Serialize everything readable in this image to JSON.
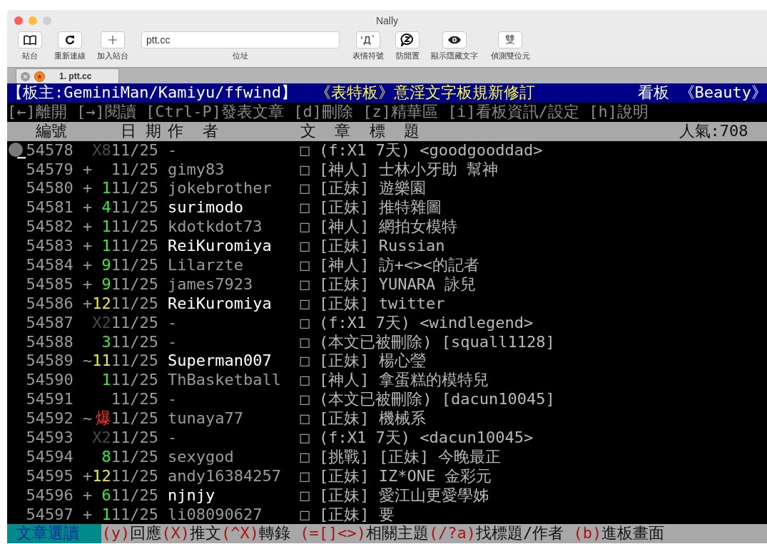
{
  "window": {
    "title": "Nally"
  },
  "toolbar": {
    "left_buttons": [
      {
        "kind": "book",
        "label": "站台"
      },
      {
        "kind": "refresh",
        "label": "重新連線"
      },
      {
        "kind": "plus",
        "label": "加入站台"
      }
    ],
    "address": {
      "value": "ptt.cc",
      "label": "位址"
    },
    "right_buttons": [
      {
        "kind": "glyph",
        "glyph": "'Д`",
        "label": "表情符號"
      },
      {
        "kind": "zbubble",
        "label": "防閒置"
      },
      {
        "kind": "eye",
        "label": "顯示隱藏文字"
      },
      {
        "kind": "glyph",
        "glyph": "雙",
        "label": "偵測雙位元"
      }
    ]
  },
  "tabs": [
    {
      "label": "1. ptt.cc",
      "selected": true
    }
  ],
  "terminal": {
    "header": {
      "moderator": "【板主:GeminiMan/Kamiyu/ffwind】",
      "title": "《表特板》意淫文字板規新修訂",
      "board_label": "看板",
      "board": "《Beauty》"
    },
    "menu": "[←]離開 [→]閱讀 [Ctrl-P]發表文章 [d]刪除 [z]精華區 [i]看板資訊/設定 [h]說明",
    "columns": {
      "number": "編號",
      "date": "日 期",
      "author": "作  者",
      "title": "文  章  標  題",
      "popularity": "人氣:708"
    },
    "rows": [
      {
        "number": "54578",
        "recommend": "X8",
        "color": "#4a4a4a",
        "date": "11/25",
        "author": "-",
        "highlighted": false,
        "box": "□",
        "title": "(f:X1 7天) <goodgooddad>",
        "selected": true
      },
      {
        "number": "54579",
        "mark": "+",
        "date": "11/25",
        "author": "gimy83",
        "highlighted": false,
        "box": "□",
        "title": "[神人] 士林小牙助 幫神",
        "selected": false
      },
      {
        "number": "54580",
        "mark": "+",
        "recommend": "1",
        "color": "#33ee33",
        "date": "11/25",
        "author": "jokebrother",
        "highlighted": false,
        "box": "□",
        "title": "[正妹] 遊樂園",
        "selected": false
      },
      {
        "number": "54581",
        "mark": "+",
        "recommend": "4",
        "color": "#33ee33",
        "date": "11/25",
        "author": "surimodo",
        "highlighted": true,
        "box": "□",
        "title": "[正妹] 推特雜圖",
        "selected": false
      },
      {
        "number": "54582",
        "mark": "+",
        "recommend": "1",
        "color": "#33ee33",
        "date": "11/25",
        "author": "kdotkdot73",
        "highlighted": false,
        "box": "□",
        "title": "[神人] 網拍女模特",
        "selected": false
      },
      {
        "number": "54583",
        "mark": "+",
        "recommend": "1",
        "color": "#33ee33",
        "date": "11/25",
        "author": "ReiKuromiya",
        "highlighted": true,
        "box": "□",
        "title": "[正妹] Russian",
        "selected": false
      },
      {
        "number": "54584",
        "mark": "+",
        "recommend": "9",
        "color": "#33ee33",
        "date": "11/25",
        "author": "Lilarzte",
        "highlighted": false,
        "box": "□",
        "title": "[神人] 訪+<><的記者",
        "selected": false
      },
      {
        "number": "54585",
        "mark": "+",
        "recommend": "9",
        "color": "#33ee33",
        "date": "11/25",
        "author": "james7923",
        "highlighted": false,
        "box": "□",
        "title": "[正妹] YUNARA 詠兒",
        "selected": false
      },
      {
        "number": "54586",
        "mark": "+",
        "recommend": "12",
        "color": "#f0f020",
        "date": "11/25",
        "author": "ReiKuromiya",
        "highlighted": true,
        "box": "□",
        "title": "[正妹] twitter",
        "selected": false
      },
      {
        "number": "54587",
        "recommend": "X2",
        "color": "#4a4a4a",
        "date": "11/25",
        "author": "-",
        "highlighted": false,
        "box": "□",
        "title": "(f:X1 7天) <windlegend>",
        "selected": false
      },
      {
        "number": "54588",
        "recommend": "3",
        "color": "#33ee33",
        "date": "11/25",
        "author": "-",
        "highlighted": false,
        "box": "□",
        "title": "(本文已被刪除) [squall1128]",
        "selected": false
      },
      {
        "number": "54589",
        "mark": "~",
        "recommend": "11",
        "color": "#f0f020",
        "date": "11/25",
        "author": "Superman007",
        "highlighted": true,
        "box": "□",
        "title": "[正妹] 楊心瑩",
        "selected": false
      },
      {
        "number": "54590",
        "recommend": "1",
        "color": "#33ee33",
        "date": "11/25",
        "author": "ThBasketball",
        "highlighted": false,
        "box": "□",
        "title": "[神人] 拿蛋糕的模特兒",
        "selected": false
      },
      {
        "number": "54591",
        "date": "11/25",
        "author": "-",
        "highlighted": false,
        "box": "□",
        "title": "(本文已被刪除) [dacun10045]",
        "selected": false
      },
      {
        "number": "54592",
        "mark": "~",
        "recommend": "爆",
        "color": "#ff3322",
        "date": "11/25",
        "author": "tunaya77",
        "highlighted": false,
        "box": "□",
        "title": "[正妹] 機械系",
        "selected": false
      },
      {
        "number": "54593",
        "recommend": "X2",
        "color": "#4a4a4a",
        "date": "11/25",
        "author": "-",
        "highlighted": false,
        "box": "□",
        "title": "(f:X1 7天) <dacun10045>",
        "selected": false
      },
      {
        "number": "54594",
        "recommend": "8",
        "color": "#33ee33",
        "date": "11/25",
        "author": "sexygod",
        "highlighted": false,
        "box": "□",
        "title": "[挑戰] [正妹] 今晚最正",
        "selected": false
      },
      {
        "number": "54595",
        "mark": "+",
        "recommend": "12",
        "color": "#f0f020",
        "date": "11/25",
        "author": "andy16384257",
        "highlighted": false,
        "box": "□",
        "title": "[正妹] IZ*ONE 金彩元",
        "selected": false
      },
      {
        "number": "54596",
        "mark": "+",
        "recommend": "6",
        "color": "#33ee33",
        "date": "11/25",
        "author": "njnjy",
        "highlighted": true,
        "box": "□",
        "title": "[正妹] 愛江山更愛學姊",
        "selected": false
      },
      {
        "number": "54597",
        "mark": "+",
        "recommend": "1",
        "color": "#33ee33",
        "date": "11/25",
        "author": "li08090627",
        "highlighted": false,
        "box": "□",
        "title": "[正妹] 要",
        "selected": false
      }
    ],
    "footer": {
      "mode": "文章選讀",
      "commands": [
        {
          "key": "(y)",
          "label": "回應"
        },
        {
          "key": "(X)",
          "label": "推文"
        },
        {
          "key": "(^X)",
          "label": "轉錄"
        },
        {
          "key": "(=[]<>)",
          "label": "相關主題"
        },
        {
          "key": "(/?a)",
          "label": "找標題/作者"
        },
        {
          "key": "(b)",
          "label": "進板畫面"
        }
      ]
    }
  }
}
